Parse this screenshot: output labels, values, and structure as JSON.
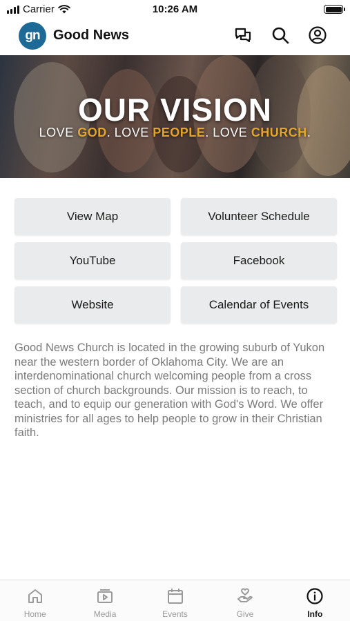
{
  "status_bar": {
    "carrier": "Carrier",
    "time": "10:26 AM"
  },
  "header": {
    "logo_text": "gn",
    "title": "Good News",
    "icons": [
      "chat-icon",
      "search-icon",
      "profile-icon"
    ]
  },
  "hero": {
    "title": "OUR VISION",
    "love_1": "LOVE ",
    "god": "GOD",
    "love_2": ". LOVE ",
    "people": "PEOPLE",
    "love_3": ". LOVE ",
    "church": "CHURCH",
    "end": "."
  },
  "buttons": {
    "view_map": "View Map",
    "volunteer_schedule": "Volunteer Schedule",
    "youtube": "YouTube",
    "facebook": "Facebook",
    "website": "Website",
    "calendar": "Calendar of Events"
  },
  "description": "Good News Church is located in the growing suburb of Yukon near the western border of Oklahoma City. We are an interdenominational church welcoming people from a cross section of church backgrounds. Our mission is to reach, to teach, and to equip our generation with God's Word. We offer ministries for all ages to help people to grow in their Christian faith.",
  "tabs": [
    {
      "label": "Home",
      "icon": "home-icon",
      "active": false
    },
    {
      "label": "Media",
      "icon": "media-icon",
      "active": false
    },
    {
      "label": "Events",
      "icon": "calendar-icon",
      "active": false
    },
    {
      "label": "Give",
      "icon": "give-icon",
      "active": false
    },
    {
      "label": "Info",
      "icon": "info-icon",
      "active": true
    }
  ],
  "colors": {
    "brand_blue": "#1e6a96",
    "accent_gold": "#e2a530",
    "button_gray": "#eaebec"
  }
}
